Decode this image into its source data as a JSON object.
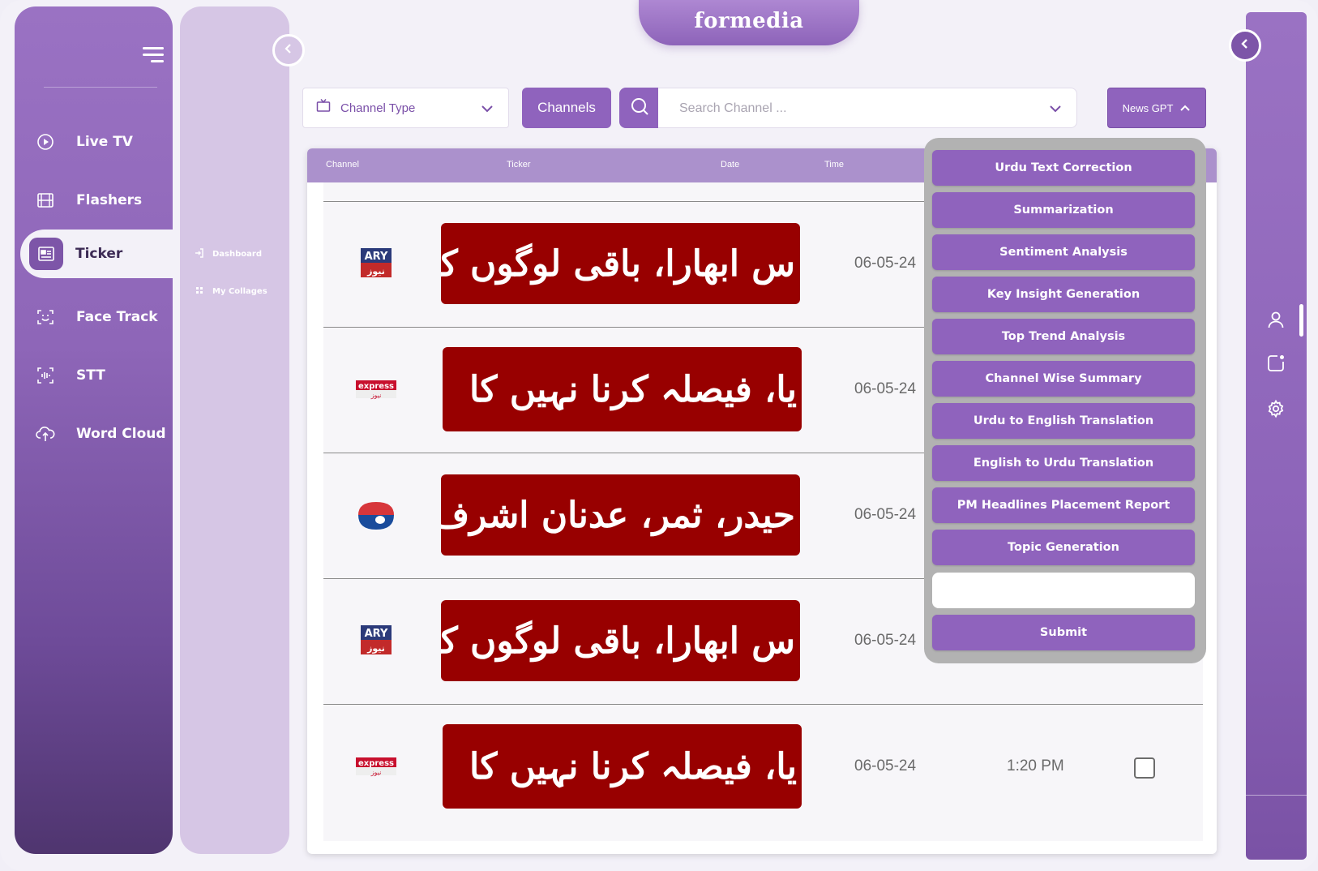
{
  "brand": {
    "logo_text": "formedia"
  },
  "sidebar": {
    "items": [
      {
        "label": "Live TV",
        "icon": "play-circle-icon"
      },
      {
        "label": "Flashers",
        "icon": "film-icon"
      },
      {
        "label": "Ticker",
        "icon": "newspaper-icon",
        "active": true
      },
      {
        "label": "Face Track",
        "icon": "face-scan-icon"
      },
      {
        "label": "STT",
        "icon": "audio-wave-icon"
      },
      {
        "label": "Word Cloud",
        "icon": "cloud-upload-icon"
      }
    ]
  },
  "subbar": {
    "items": [
      {
        "label": "Dashboard",
        "icon": "login-arrow-icon"
      },
      {
        "label": "My Collages",
        "icon": "grid-icon"
      }
    ]
  },
  "toolbar": {
    "channel_type_label": "Channel Type",
    "channels_label": "Channels",
    "search_placeholder": "Search Channel ...",
    "news_gpt_label": "News GPT"
  },
  "table": {
    "headers": {
      "channel": "Channel",
      "ticker": "Ticker",
      "date": "Date",
      "time": "Time"
    },
    "rows": [
      {
        "channel": "ARY News",
        "logo_text": "ARY",
        "logo_sub": "نیوز",
        "ticker_text": "س ابھارا، باقی لوگوں کا کچھ نہیں",
        "date": "06-05-24",
        "time": ""
      },
      {
        "channel": "Express News",
        "logo_text": "express",
        "logo_sub": "نیوز",
        "ticker_text": "یا، فیصلہ کرنا نہیں کا",
        "date": "06-05-24",
        "time": ""
      },
      {
        "channel": "Geo News",
        "logo_text": "",
        "logo_sub": "",
        "ticker_text": "حیدر، ثمر، عدنان اشرف دیگ",
        "date": "06-05-24",
        "time": ""
      },
      {
        "channel": "ARY News",
        "logo_text": "ARY",
        "logo_sub": "نیوز",
        "ticker_text": "س ابھارا، باقی لوگوں کا کچھ نہیں",
        "date": "06-05-24",
        "time": ""
      },
      {
        "channel": "Express News",
        "logo_text": "express",
        "logo_sub": "نیوز",
        "ticker_text": "یا، فیصلہ کرنا نہیں کا",
        "date": "06-05-24",
        "time": "1:20 PM"
      }
    ]
  },
  "news_gpt": {
    "options": [
      "Urdu Text Correction",
      "Summarization",
      "Sentiment Analysis",
      "Key Insight Generation",
      "Top Trend Analysis",
      "Channel Wise Summary",
      "Urdu to English Translation",
      "English to Urdu Translation",
      "PM Headlines Placement Report",
      "Topic Generation"
    ],
    "input_value": "",
    "submit_label": "Submit"
  },
  "colors": {
    "primary": "#8f63bd",
    "sidebar_top": "#9a72c3",
    "sidebar_bottom": "#4f356f",
    "ticker_red": "#980000",
    "panel_gray": "#b2b2b2"
  }
}
